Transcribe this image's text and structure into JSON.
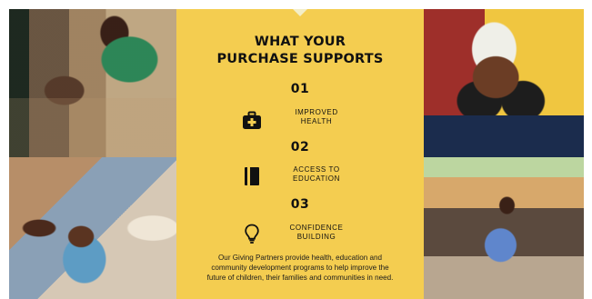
{
  "heading": {
    "line1": "WHAT YOUR",
    "line2": "PURCHASE SUPPORTS"
  },
  "items": [
    {
      "number": "01",
      "label_line1": "IMPROVED",
      "label_line2": "HEALTH",
      "icon": "first-aid-kit-icon"
    },
    {
      "number": "02",
      "label_line1": "ACCESS TO",
      "label_line2": "EDUCATION",
      "icon": "book-icon"
    },
    {
      "number": "03",
      "label_line1": "CONFIDENCE",
      "label_line2": "BUILDING",
      "icon": "lightbulb-icon"
    }
  ],
  "description": "Our Giving Partners provide health, education and community development programs to help improve the future of children, their families and communities in need.",
  "colors": {
    "panel": "#f4cd50",
    "text": "#111111"
  }
}
